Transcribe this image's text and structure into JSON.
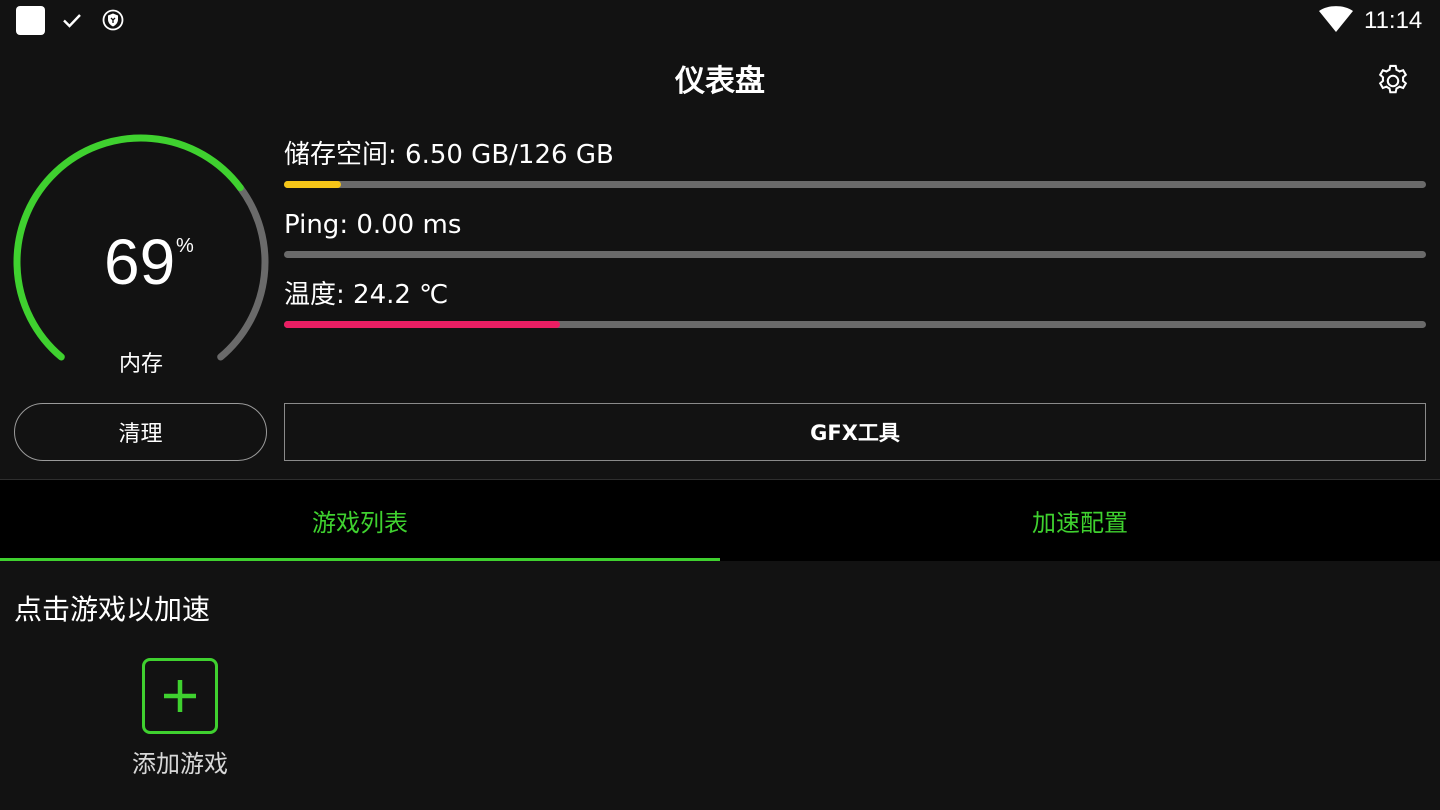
{
  "status_bar": {
    "time": "11:14",
    "icons": [
      "app-square-icon",
      "check-icon",
      "shield-icon",
      "wifi-icon"
    ]
  },
  "header": {
    "title": "仪表盘",
    "settings_icon": "gear-icon"
  },
  "memory": {
    "value": "69",
    "unit": "%",
    "label": "内存",
    "percent": 69,
    "color": "#3fd12f"
  },
  "stats": {
    "storage": {
      "label": "储存空间: 6.50 GB/126 GB",
      "fraction": 0.05,
      "color": "#f5c518"
    },
    "ping": {
      "label": "Ping: 0.00 ms",
      "fraction": 0,
      "color": "#3fd12f"
    },
    "temperature": {
      "label": "温度: 24.2 ℃",
      "fraction": 0.242,
      "color": "#e91e63"
    }
  },
  "buttons": {
    "clean": "清理",
    "gfx": "GFX工具"
  },
  "tabs": [
    {
      "label": "游戏列表",
      "active": true
    },
    {
      "label": "加速配置",
      "active": false
    }
  ],
  "content": {
    "section_title": "点击游戏以加速",
    "add_game_label": "添加游戏"
  },
  "colors": {
    "accent": "#3fd12f",
    "background": "#121212",
    "track": "#6a6a6a"
  }
}
